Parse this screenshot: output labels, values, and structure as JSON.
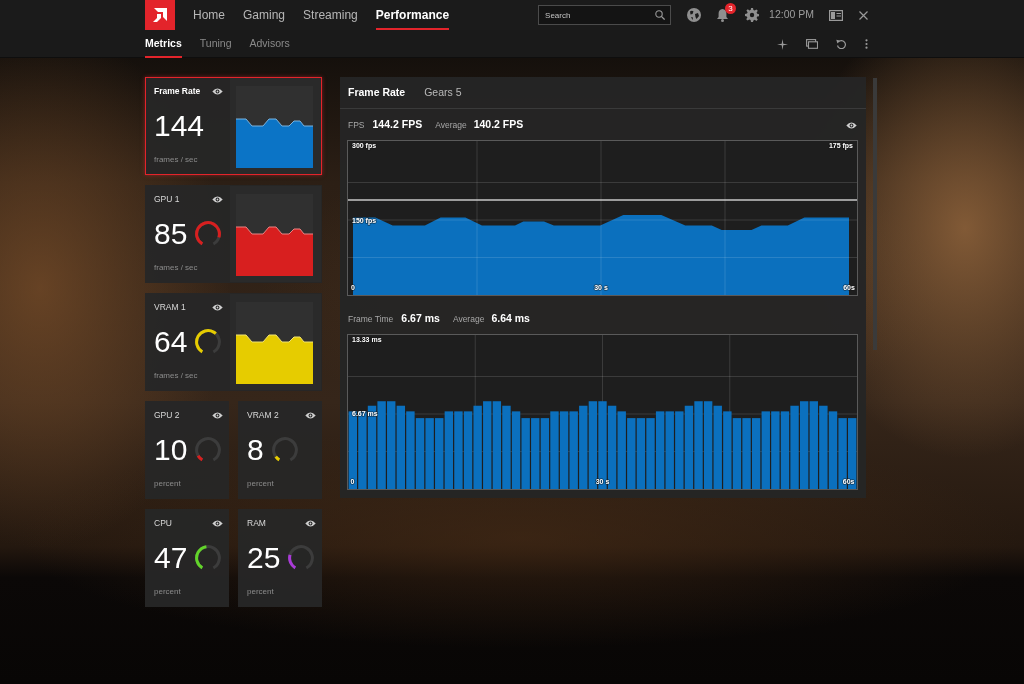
{
  "top_bar": {
    "nav": [
      {
        "label": "Home",
        "selected": false
      },
      {
        "label": "Gaming",
        "selected": false
      },
      {
        "label": "Streaming",
        "selected": false
      },
      {
        "label": "Performance",
        "selected": true
      }
    ],
    "search": {
      "placeholder": "Search"
    },
    "notifications_badge": "3",
    "clock": "12:00 PM"
  },
  "sub_tabs": [
    {
      "label": "Metrics",
      "selected": true
    },
    {
      "label": "Tuning",
      "selected": false
    },
    {
      "label": "Advisors",
      "selected": false
    }
  ],
  "metrics": [
    {
      "kind": "wide",
      "label": "Frame Rate",
      "value": "144",
      "unit": "frames / sec",
      "selected": true,
      "color": "#0b74c6"
    },
    {
      "kind": "wide",
      "label": "GPU 1",
      "value": "85",
      "unit": "frames / sec",
      "selected": false,
      "color": "#d81f1f",
      "level": 0.85
    },
    {
      "kind": "wide",
      "label": "VRAM 1",
      "value": "64",
      "unit": "frames / sec",
      "selected": false,
      "color": "#e6cc00",
      "level": 0.64
    },
    {
      "kind": "compact",
      "label": "GPU 2",
      "value": "10",
      "unit": "percent",
      "selected": false,
      "color": "#d81f1f",
      "level": 0.1
    },
    {
      "kind": "compact",
      "label": "VRAM 2",
      "value": "8",
      "unit": "percent",
      "selected": false,
      "color": "#e6cc00",
      "level": 0.08
    },
    {
      "kind": "compact",
      "label": "CPU",
      "value": "47",
      "unit": "percent",
      "selected": false,
      "color": "#62d42a",
      "level": 0.47
    },
    {
      "kind": "compact",
      "label": "RAM",
      "value": "25",
      "unit": "percent",
      "selected": false,
      "color": "#aa3ad8",
      "level": 0.25
    }
  ],
  "detail": {
    "title": "Frame Rate",
    "game": "Gears 5",
    "sections": [
      {
        "label": "FPS",
        "value": "144.2 FPS",
        "average_label": "Average",
        "average": "140.2 FPS",
        "show_toggle": true,
        "chart_data": {
          "type": "area",
          "x": [
            0,
            2.7,
            4.8,
            8.7,
            10.6,
            13.6,
            15.6,
            19.6,
            20.6,
            23.1,
            24.3,
            29.9,
            32.7,
            37.3,
            40.2,
            43.4,
            44.6,
            48.2,
            49.4,
            52.6,
            54.6,
            60
          ],
          "values": [
            155,
            155,
            139,
            139,
            155,
            155,
            139,
            139,
            147,
            147,
            139,
            139,
            160,
            160,
            139,
            139,
            130,
            130,
            139,
            139,
            155,
            155
          ],
          "xlim": [
            0,
            60
          ],
          "ylim": [
            0,
            300
          ],
          "xticks": [
            {
              "value": 0,
              "label": "0"
            },
            {
              "value": 30,
              "label": "30 s"
            },
            {
              "value": 60,
              "label": "60s"
            }
          ],
          "yticks": [
            {
              "value": 150,
              "label": "150 fps"
            },
            {
              "value": 300,
              "label": "300 fps"
            }
          ],
          "ref_lines": [
            {
              "axis": "y",
              "value": 190
            }
          ],
          "annotations": [
            "175 fps"
          ]
        }
      },
      {
        "label": "Frame Time",
        "value": "6.67 ms",
        "average_label": "Average",
        "average": "6.64 ms",
        "show_toggle": false,
        "chart_data": {
          "type": "bar",
          "categories": [
            "0",
            null,
            null,
            null,
            null,
            null,
            null,
            null,
            null,
            null,
            null,
            null,
            null,
            null,
            null,
            null,
            null,
            null,
            null,
            null,
            null,
            null,
            null,
            null,
            null,
            null,
            "30 s",
            null,
            null,
            null,
            null,
            null,
            null,
            null,
            null,
            null,
            null,
            null,
            null,
            null,
            null,
            null,
            null,
            null,
            null,
            null,
            null,
            null,
            null,
            null,
            null,
            null,
            "60s"
          ],
          "values": [
            6.9,
            6.9,
            7.4,
            7.8,
            7.8,
            7.4,
            6.9,
            6.3,
            6.3,
            6.3,
            6.9,
            6.9,
            6.9,
            7.4,
            7.8,
            7.8,
            7.4,
            6.9,
            6.3,
            6.3,
            6.3,
            6.9,
            6.9,
            6.9,
            7.4,
            7.8,
            7.8,
            7.4,
            6.9,
            6.3,
            6.3,
            6.3,
            6.9,
            6.9,
            6.9,
            7.4,
            7.8,
            7.8,
            7.4,
            6.9,
            6.3,
            6.3,
            6.3,
            6.9,
            6.9,
            6.9,
            7.4,
            7.8,
            7.8,
            7.4,
            6.9,
            6.3,
            6.3
          ],
          "ylim": [
            0,
            13.33
          ],
          "yticks": [
            {
              "value": 6.67,
              "label": "6.67 ms"
            },
            {
              "value": 13.33,
              "label": "13.33 ms"
            }
          ]
        }
      }
    ]
  }
}
